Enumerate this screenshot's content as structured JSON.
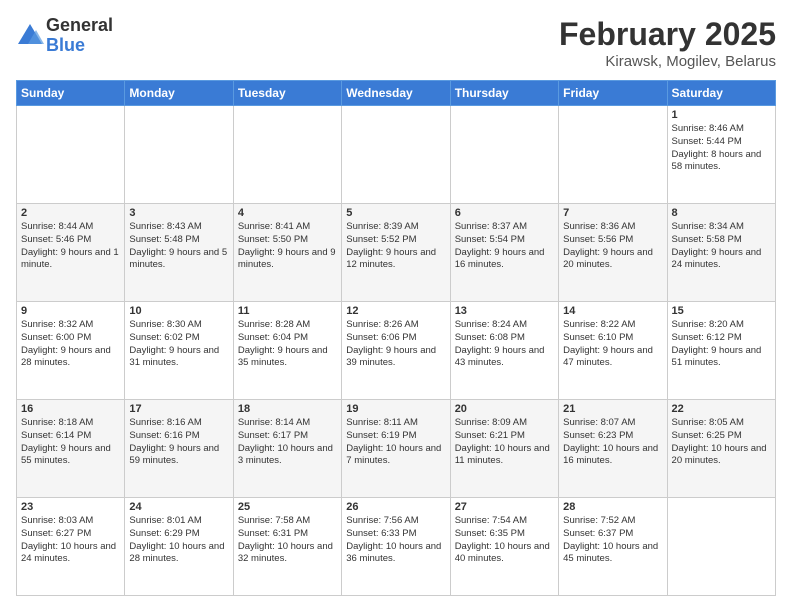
{
  "logo": {
    "general": "General",
    "blue": "Blue"
  },
  "title": {
    "month": "February 2025",
    "location": "Kirawsk, Mogilev, Belarus"
  },
  "headers": [
    "Sunday",
    "Monday",
    "Tuesday",
    "Wednesday",
    "Thursday",
    "Friday",
    "Saturday"
  ],
  "weeks": [
    {
      "days": [
        {
          "num": "",
          "info": ""
        },
        {
          "num": "",
          "info": ""
        },
        {
          "num": "",
          "info": ""
        },
        {
          "num": "",
          "info": ""
        },
        {
          "num": "",
          "info": ""
        },
        {
          "num": "",
          "info": ""
        },
        {
          "num": "1",
          "info": "Sunrise: 8:46 AM\nSunset: 5:44 PM\nDaylight: 8 hours and 58 minutes."
        }
      ]
    },
    {
      "days": [
        {
          "num": "2",
          "info": "Sunrise: 8:44 AM\nSunset: 5:46 PM\nDaylight: 9 hours and 1 minute."
        },
        {
          "num": "3",
          "info": "Sunrise: 8:43 AM\nSunset: 5:48 PM\nDaylight: 9 hours and 5 minutes."
        },
        {
          "num": "4",
          "info": "Sunrise: 8:41 AM\nSunset: 5:50 PM\nDaylight: 9 hours and 9 minutes."
        },
        {
          "num": "5",
          "info": "Sunrise: 8:39 AM\nSunset: 5:52 PM\nDaylight: 9 hours and 12 minutes."
        },
        {
          "num": "6",
          "info": "Sunrise: 8:37 AM\nSunset: 5:54 PM\nDaylight: 9 hours and 16 minutes."
        },
        {
          "num": "7",
          "info": "Sunrise: 8:36 AM\nSunset: 5:56 PM\nDaylight: 9 hours and 20 minutes."
        },
        {
          "num": "8",
          "info": "Sunrise: 8:34 AM\nSunset: 5:58 PM\nDaylight: 9 hours and 24 minutes."
        }
      ]
    },
    {
      "days": [
        {
          "num": "9",
          "info": "Sunrise: 8:32 AM\nSunset: 6:00 PM\nDaylight: 9 hours and 28 minutes."
        },
        {
          "num": "10",
          "info": "Sunrise: 8:30 AM\nSunset: 6:02 PM\nDaylight: 9 hours and 31 minutes."
        },
        {
          "num": "11",
          "info": "Sunrise: 8:28 AM\nSunset: 6:04 PM\nDaylight: 9 hours and 35 minutes."
        },
        {
          "num": "12",
          "info": "Sunrise: 8:26 AM\nSunset: 6:06 PM\nDaylight: 9 hours and 39 minutes."
        },
        {
          "num": "13",
          "info": "Sunrise: 8:24 AM\nSunset: 6:08 PM\nDaylight: 9 hours and 43 minutes."
        },
        {
          "num": "14",
          "info": "Sunrise: 8:22 AM\nSunset: 6:10 PM\nDaylight: 9 hours and 47 minutes."
        },
        {
          "num": "15",
          "info": "Sunrise: 8:20 AM\nSunset: 6:12 PM\nDaylight: 9 hours and 51 minutes."
        }
      ]
    },
    {
      "days": [
        {
          "num": "16",
          "info": "Sunrise: 8:18 AM\nSunset: 6:14 PM\nDaylight: 9 hours and 55 minutes."
        },
        {
          "num": "17",
          "info": "Sunrise: 8:16 AM\nSunset: 6:16 PM\nDaylight: 9 hours and 59 minutes."
        },
        {
          "num": "18",
          "info": "Sunrise: 8:14 AM\nSunset: 6:17 PM\nDaylight: 10 hours and 3 minutes."
        },
        {
          "num": "19",
          "info": "Sunrise: 8:11 AM\nSunset: 6:19 PM\nDaylight: 10 hours and 7 minutes."
        },
        {
          "num": "20",
          "info": "Sunrise: 8:09 AM\nSunset: 6:21 PM\nDaylight: 10 hours and 11 minutes."
        },
        {
          "num": "21",
          "info": "Sunrise: 8:07 AM\nSunset: 6:23 PM\nDaylight: 10 hours and 16 minutes."
        },
        {
          "num": "22",
          "info": "Sunrise: 8:05 AM\nSunset: 6:25 PM\nDaylight: 10 hours and 20 minutes."
        }
      ]
    },
    {
      "days": [
        {
          "num": "23",
          "info": "Sunrise: 8:03 AM\nSunset: 6:27 PM\nDaylight: 10 hours and 24 minutes."
        },
        {
          "num": "24",
          "info": "Sunrise: 8:01 AM\nSunset: 6:29 PM\nDaylight: 10 hours and 28 minutes."
        },
        {
          "num": "25",
          "info": "Sunrise: 7:58 AM\nSunset: 6:31 PM\nDaylight: 10 hours and 32 minutes."
        },
        {
          "num": "26",
          "info": "Sunrise: 7:56 AM\nSunset: 6:33 PM\nDaylight: 10 hours and 36 minutes."
        },
        {
          "num": "27",
          "info": "Sunrise: 7:54 AM\nSunset: 6:35 PM\nDaylight: 10 hours and 40 minutes."
        },
        {
          "num": "28",
          "info": "Sunrise: 7:52 AM\nSunset: 6:37 PM\nDaylight: 10 hours and 45 minutes."
        },
        {
          "num": "",
          "info": ""
        }
      ]
    }
  ]
}
